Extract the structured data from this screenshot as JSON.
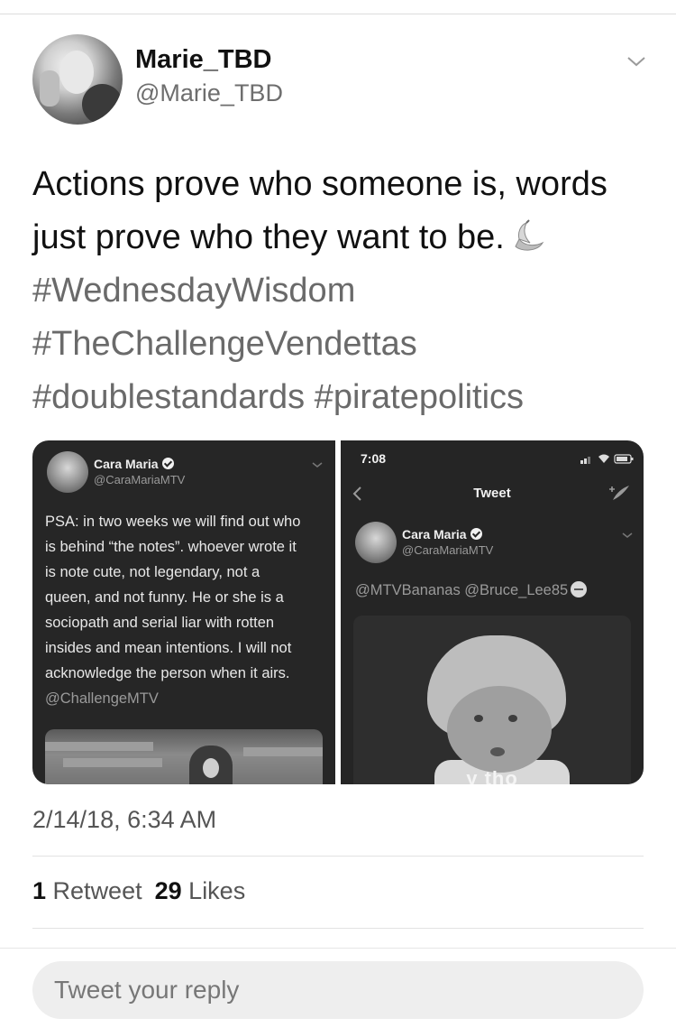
{
  "author": {
    "name": "Marie_TBD",
    "handle": "@Marie_TBD"
  },
  "tweet": {
    "lines": [
      "Actions prove who someone is, words",
      "just prove who they want to be.",
      "#WednesdayWisdom",
      "#TheChallengeVendettas",
      "#doublestandards #piratepolitics"
    ],
    "emoji_icon": "banana-icon",
    "timestamp": "2/14/18, 6:34 AM"
  },
  "media": {
    "left": {
      "name": "Cara Maria",
      "handle": "@CaraMariaMTV",
      "lines": [
        "PSA: in two weeks we will find out who",
        "is behind “the notes”. whoever wrote it",
        "is note cute, not legendary, not a",
        "queen, and not funny. He or she is a",
        "sociopath and serial liar with rotten",
        "insides and mean intentions. I will not",
        "acknowledge the person when it airs."
      ],
      "mention": "@ChallengeMTV"
    },
    "right": {
      "status_time": "7:08",
      "nav_title": "Tweet",
      "name": "Cara Maria",
      "handle": "@CaraMariaMTV",
      "reply_text": "@MTVBananas @Bruce_Lee85",
      "meme_caption": "y tho"
    }
  },
  "stats": {
    "retweets_count": "1",
    "retweets_label": "Retweet",
    "likes_count": "29",
    "likes_label": "Likes"
  },
  "reply": {
    "placeholder": "Tweet your reply"
  },
  "colors": {
    "hashtag": "#6a6a6a",
    "panel_bg": "#262626"
  }
}
